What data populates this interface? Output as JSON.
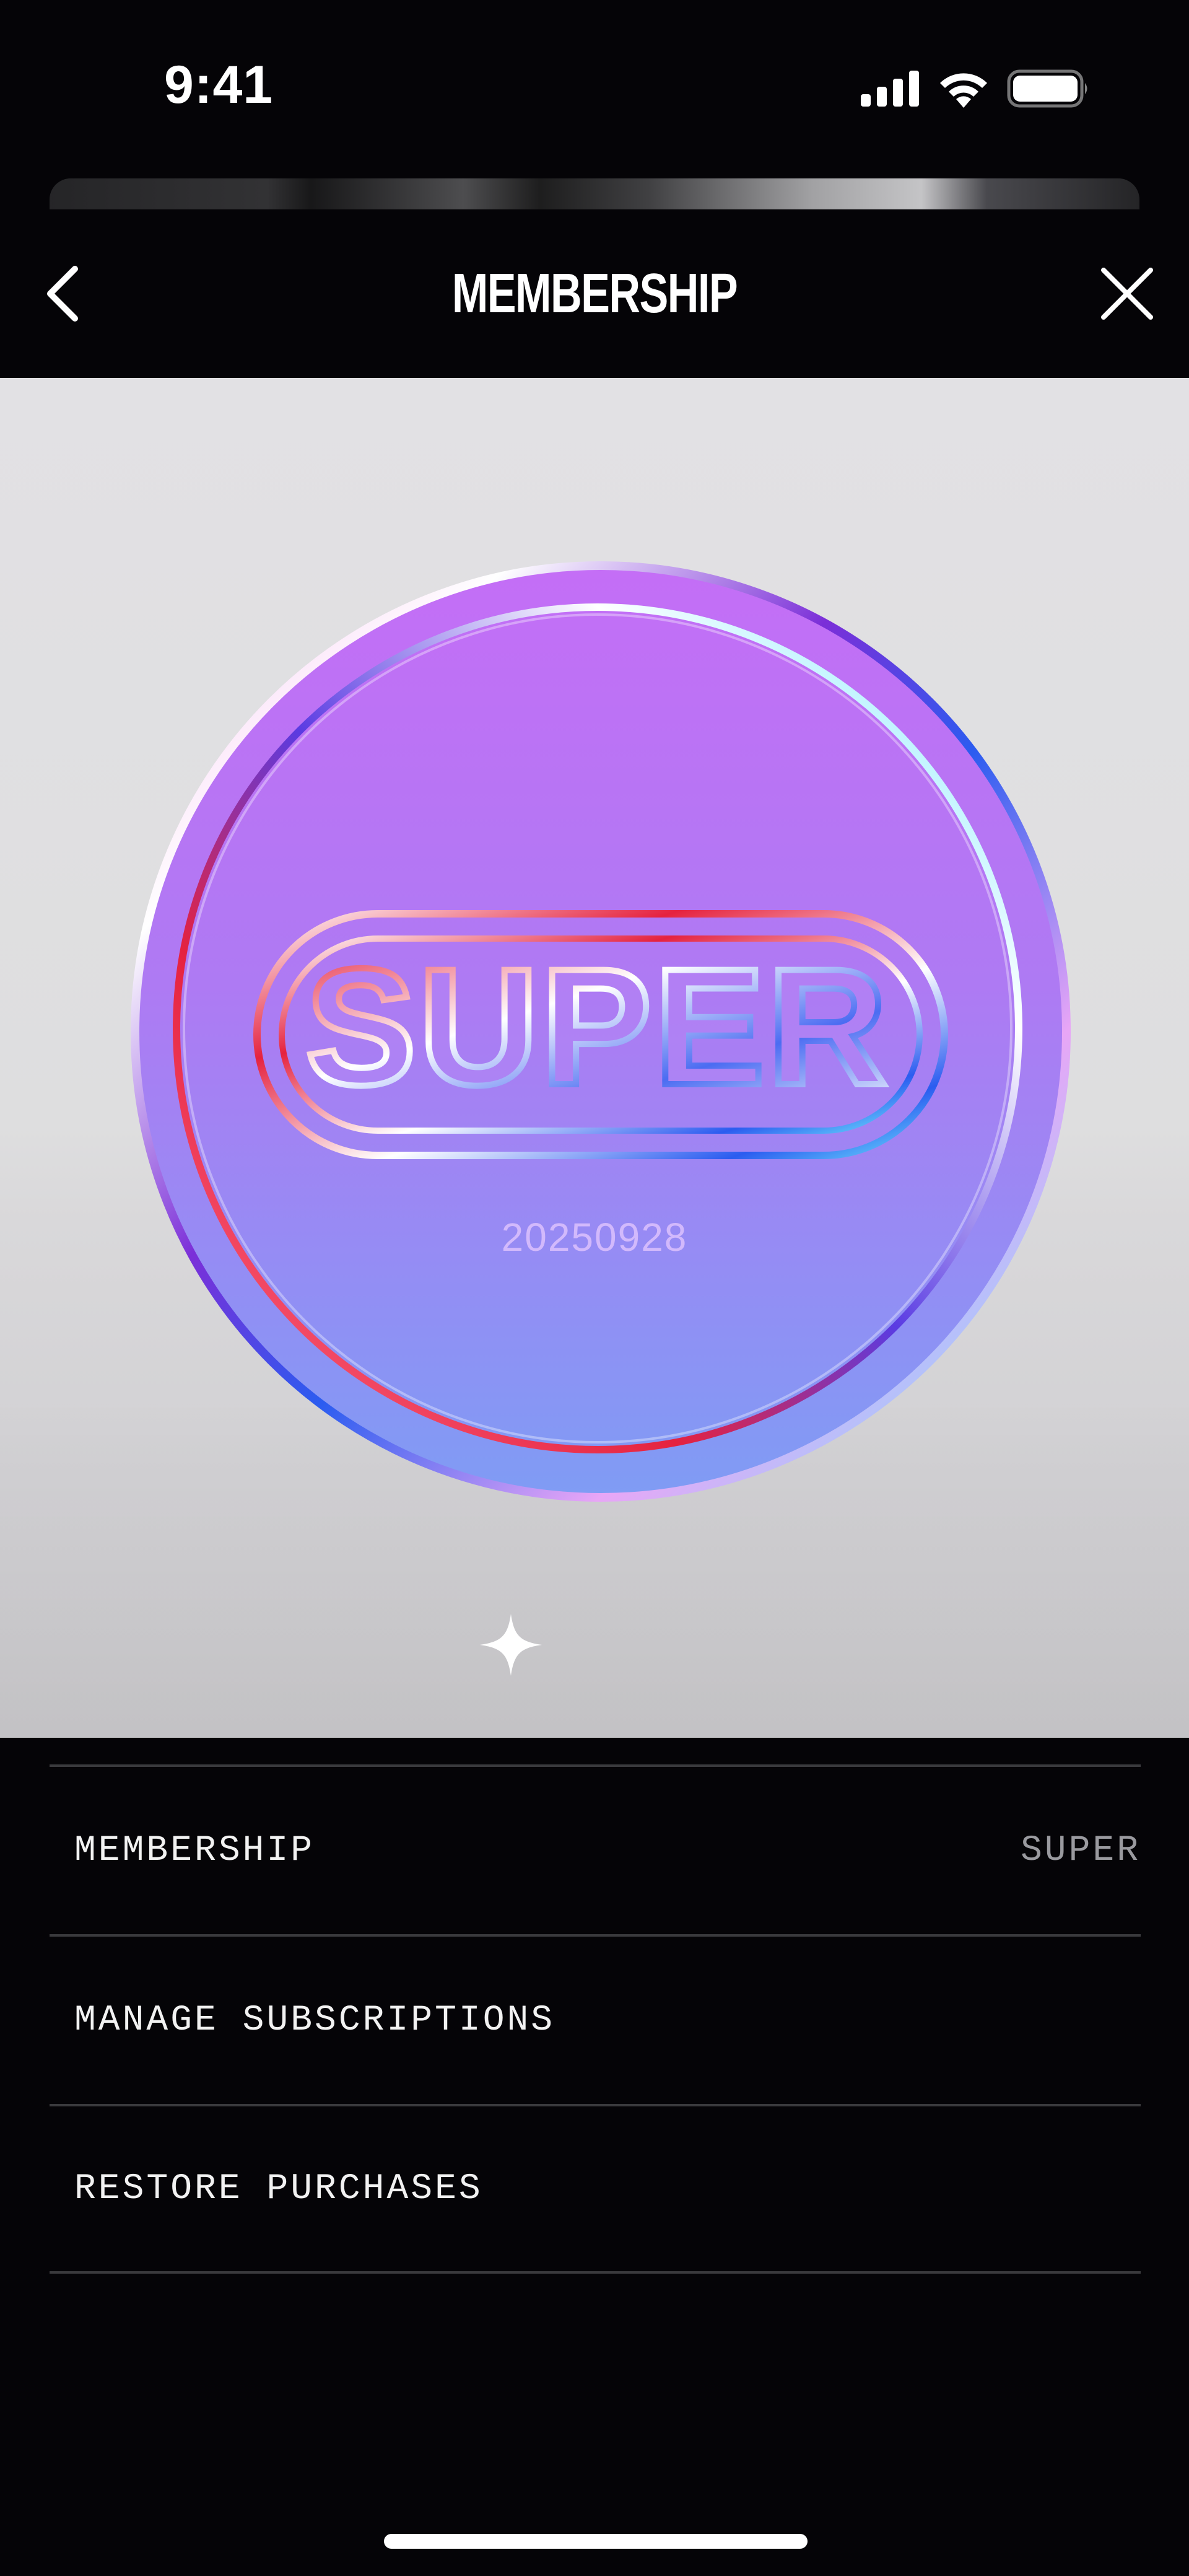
{
  "status_bar": {
    "time": "9:41",
    "icons": [
      "cellular-signal-icon",
      "wifi-icon",
      "battery-icon"
    ]
  },
  "header": {
    "title": "MEMBERSHIP",
    "back_icon": "chevron-left-icon",
    "close_icon": "close-icon"
  },
  "coin": {
    "label": "SUPER",
    "serial": "20250928",
    "colors": {
      "top": "#c46ef6",
      "bottom": "#7f9cf4",
      "rim_blue": "#2b5cf0",
      "rim_red": "#e5223f",
      "rim_cyan": "#6fe6ff"
    }
  },
  "sparkle_icon": "sparkle-icon",
  "settings": {
    "items": [
      {
        "label": "MEMBERSHIP",
        "value": "SUPER"
      },
      {
        "label": "MANAGE SUBSCRIPTIONS",
        "value": ""
      },
      {
        "label": "RESTORE PURCHASES",
        "value": ""
      }
    ]
  },
  "colors": {
    "background": "#050407",
    "divider": "#3a3a3d",
    "stage": "#dededf"
  }
}
